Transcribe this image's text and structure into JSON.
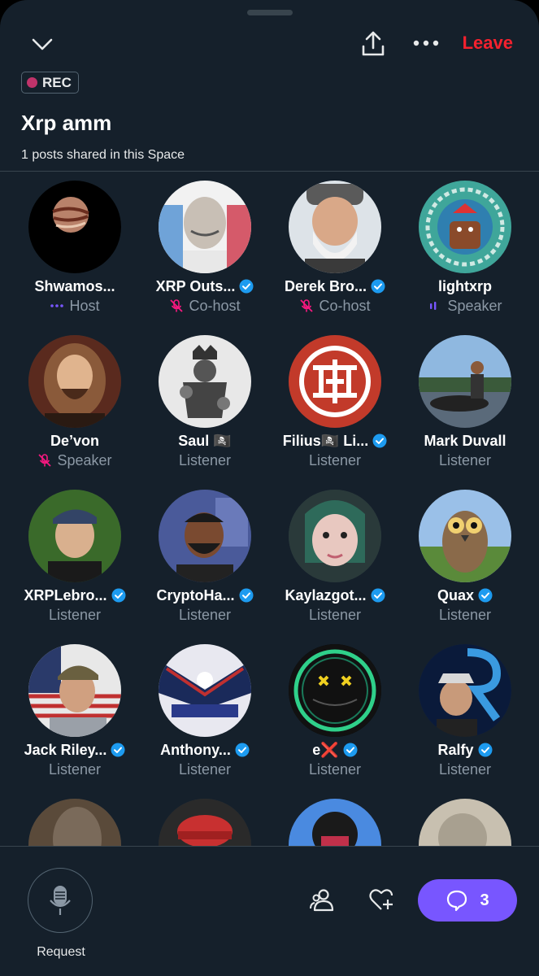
{
  "header": {
    "collapse_icon": "chevron-down-icon",
    "share_icon": "share-icon",
    "more_icon": "more-icon",
    "leave_label": "Leave",
    "leave_color": "#f4212e"
  },
  "space": {
    "rec_label": "REC",
    "title": "Xrp amm",
    "posts_shared": "1 posts shared in this Space"
  },
  "participants": [
    {
      "name": "Shwamos...",
      "role": "Host",
      "verified": false,
      "role_icon": "host-dots-icon"
    },
    {
      "name": "XRP Outs...",
      "role": "Co-host",
      "verified": true,
      "role_icon": "mic-muted-icon"
    },
    {
      "name": "Derek Bro...",
      "role": "Co-host",
      "verified": true,
      "role_icon": "mic-muted-icon"
    },
    {
      "name": "lightxrp",
      "role": "Speaker",
      "verified": false,
      "role_icon": "speaking-bars-icon"
    },
    {
      "name": "De’von",
      "role": "Speaker",
      "verified": false,
      "role_icon": "mic-muted-icon"
    },
    {
      "name": "Saul 🏴‍☠️",
      "role": "Listener",
      "verified": false
    },
    {
      "name": "Filius🏴‍☠️ Li...",
      "role": "Listener",
      "verified": true
    },
    {
      "name": "Mark Duvall",
      "role": "Listener",
      "verified": false
    },
    {
      "name": "XRPLebro...",
      "role": "Listener",
      "verified": true
    },
    {
      "name": "CryptoHa...",
      "role": "Listener",
      "verified": true
    },
    {
      "name": "Kaylazgot...",
      "role": "Listener",
      "verified": true
    },
    {
      "name": "Quax",
      "role": "Listener",
      "verified": true
    },
    {
      "name": "Jack Riley...",
      "role": "Listener",
      "verified": true
    },
    {
      "name": "Anthony...",
      "role": "Listener",
      "verified": true
    },
    {
      "name": "e❌",
      "role": "Listener",
      "verified": true
    },
    {
      "name": "Ralfy",
      "role": "Listener",
      "verified": true
    },
    {
      "name": "",
      "role": "",
      "verified": false
    },
    {
      "name": "",
      "role": "",
      "verified": false
    },
    {
      "name": "",
      "role": "",
      "verified": false
    },
    {
      "name": "",
      "role": "",
      "verified": false
    }
  ],
  "footer": {
    "request_label": "Request",
    "people_icon": "people-icon",
    "heart_plus_icon": "heart-plus-icon",
    "chat_count": "3",
    "chat_color": "#7856ff"
  },
  "colors": {
    "background": "#15202b",
    "verified": "#1d9bf0",
    "muted_mic": "#f91880",
    "host_accent": "#7856ff"
  }
}
